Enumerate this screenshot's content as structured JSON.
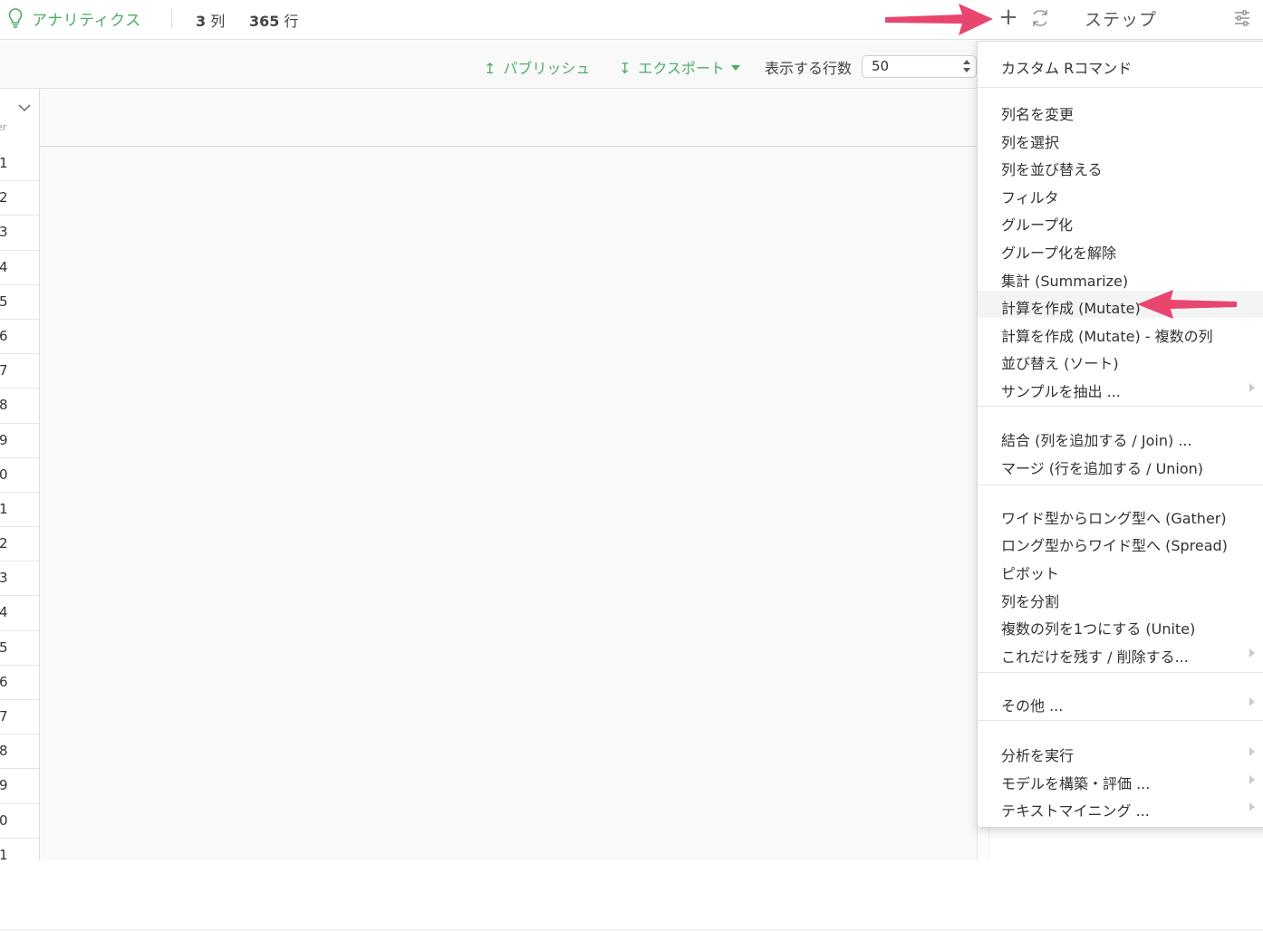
{
  "header": {
    "app_title": "アナリティクス",
    "col_count": "3",
    "col_unit": "列",
    "row_count": "365",
    "row_unit": "行",
    "plus_symbol": "+",
    "steps_title": "ステップ"
  },
  "toolbar": {
    "publish_icon": "↥",
    "publish_label": "パブリッシュ",
    "export_icon": "↧",
    "export_label": "エクスポート",
    "rows_label": "表示する行数",
    "rows_value": "50"
  },
  "grid": {
    "column_type_fragment": "er",
    "row_numbers": [
      "1",
      "2",
      "3",
      "4",
      "5",
      "6",
      "7",
      "8",
      "9",
      "0",
      "1",
      "2",
      "3",
      "4",
      "5",
      "6",
      "7",
      "8",
      "9",
      "0",
      "1"
    ]
  },
  "menu": {
    "items": [
      {
        "label": "カスタム Rコマンド",
        "has_submenu": false
      },
      {
        "label": "列名を変更",
        "has_submenu": false
      },
      {
        "label": "列を選択",
        "has_submenu": false
      },
      {
        "label": "列を並び替える",
        "has_submenu": false
      },
      {
        "label": "フィルタ",
        "has_submenu": false
      },
      {
        "label": "グループ化",
        "has_submenu": false
      },
      {
        "label": "グループ化を解除",
        "has_submenu": false
      },
      {
        "label": "集計 (Summarize)",
        "has_submenu": false
      },
      {
        "label": "計算を作成 (Mutate)",
        "has_submenu": false,
        "highlighted": true
      },
      {
        "label": "計算を作成 (Mutate) - 複数の列",
        "has_submenu": false
      },
      {
        "label": "並び替え (ソート)",
        "has_submenu": false
      },
      {
        "label": "サンプルを抽出 ...",
        "has_submenu": true
      },
      {
        "label": "結合 (列を追加する / Join) ...",
        "has_submenu": false
      },
      {
        "label": "マージ (行を追加する / Union)",
        "has_submenu": false
      },
      {
        "label": "ワイド型からロング型へ (Gather)",
        "has_submenu": false
      },
      {
        "label": "ロング型からワイド型へ (Spread)",
        "has_submenu": false
      },
      {
        "label": "ピボット",
        "has_submenu": false
      },
      {
        "label": "列を分割",
        "has_submenu": false
      },
      {
        "label": "複数の列を1つにする (Unite)",
        "has_submenu": false
      },
      {
        "label": "これだけを残す / 削除する...",
        "has_submenu": true
      },
      {
        "label": "その他 ...",
        "has_submenu": true
      },
      {
        "label": "分析を実行",
        "has_submenu": true
      },
      {
        "label": "モデルを構築・評価 ...",
        "has_submenu": true
      },
      {
        "label": "テキストマイニング ...",
        "has_submenu": true
      }
    ]
  },
  "colors": {
    "accent_green": "#4cae6a",
    "annotation_pink": "#e8456f"
  },
  "icons": {
    "app": "lightbulb-icon",
    "add": "plus-icon",
    "refresh": "refresh-icon",
    "settings": "sliders-icon",
    "publish": "upload-arrow-icon",
    "export": "download-arrow-icon"
  }
}
